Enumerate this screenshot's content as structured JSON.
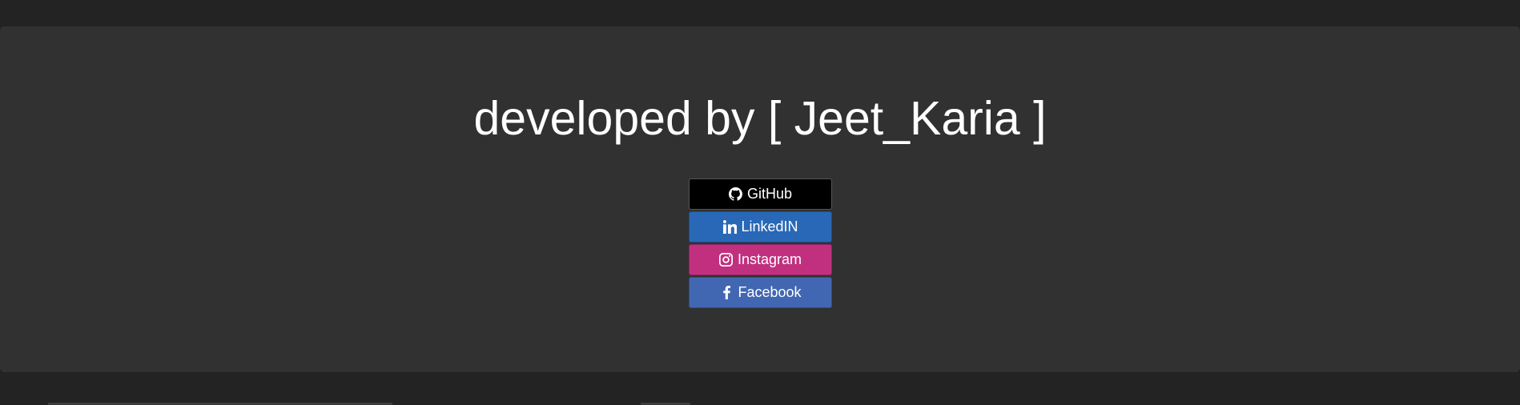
{
  "header": {
    "title": "developed by [ Jeet_Karia ]"
  },
  "links": [
    {
      "label": "GitHub",
      "icon": "github-icon",
      "color": "#000000"
    },
    {
      "label": "LinkedIN",
      "icon": "linkedin-icon",
      "color": "#2868b7"
    },
    {
      "label": "Instagram",
      "icon": "instagram-icon",
      "color": "#c1307f"
    },
    {
      "label": "Facebook",
      "icon": "facebook-icon",
      "color": "#4267b2"
    }
  ],
  "colors": {
    "page_background": "#232323",
    "card_background": "#313131",
    "text": "#ffffff"
  }
}
